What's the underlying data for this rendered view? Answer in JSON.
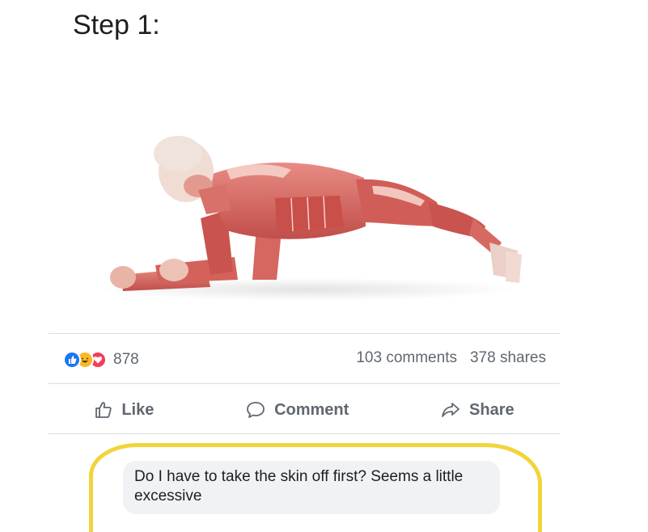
{
  "post": {
    "caption": "Step 1:",
    "image_subject": "anatomical-muscle-figure-plank"
  },
  "reactions": {
    "icons": [
      "like-reaction-icon",
      "haha-reaction-icon",
      "love-reaction-icon"
    ],
    "count": "878"
  },
  "stats": {
    "comments": "103 comments",
    "shares": "378 shares"
  },
  "actions": {
    "like": "Like",
    "comment": "Comment",
    "share": "Share"
  },
  "comment": {
    "text": "Do I have to take the skin off first? Seems a little excessive"
  },
  "colors": {
    "like_blue": "#1877f2",
    "haha_yellow": "#f7b928",
    "love_red": "#f33e58",
    "highlight": "#f2d43a",
    "muscle": "#d9625c"
  }
}
